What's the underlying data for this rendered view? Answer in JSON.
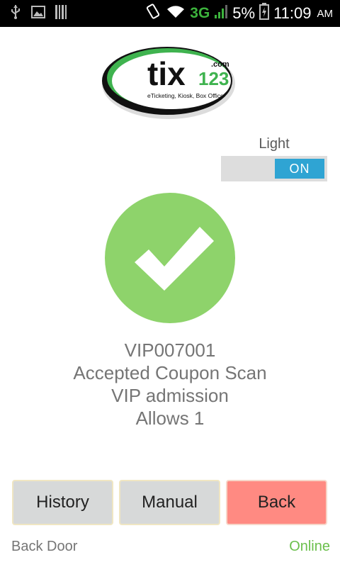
{
  "status_bar": {
    "network": "3G",
    "battery": "5%",
    "time": "11:09",
    "ampm": "AM"
  },
  "logo": {
    "name": "tix",
    "number": "123",
    "dotcom": ".com",
    "tagline": "eTicketing, Kiosk, Box Office"
  },
  "light_toggle": {
    "label": "Light",
    "state": "ON"
  },
  "result": {
    "code": "VIP007001",
    "status": "Accepted Coupon Scan",
    "admission": "VIP admission",
    "allows": "Allows 1"
  },
  "buttons": {
    "history": "History",
    "manual": "Manual",
    "back": "Back"
  },
  "footer": {
    "location": "Back Door",
    "connection": "Online"
  },
  "colors": {
    "check_green": "#8ed36b",
    "toggle_blue": "#2fa4d3",
    "back_red": "#ff8a82",
    "online_green": "#6abf4b"
  }
}
